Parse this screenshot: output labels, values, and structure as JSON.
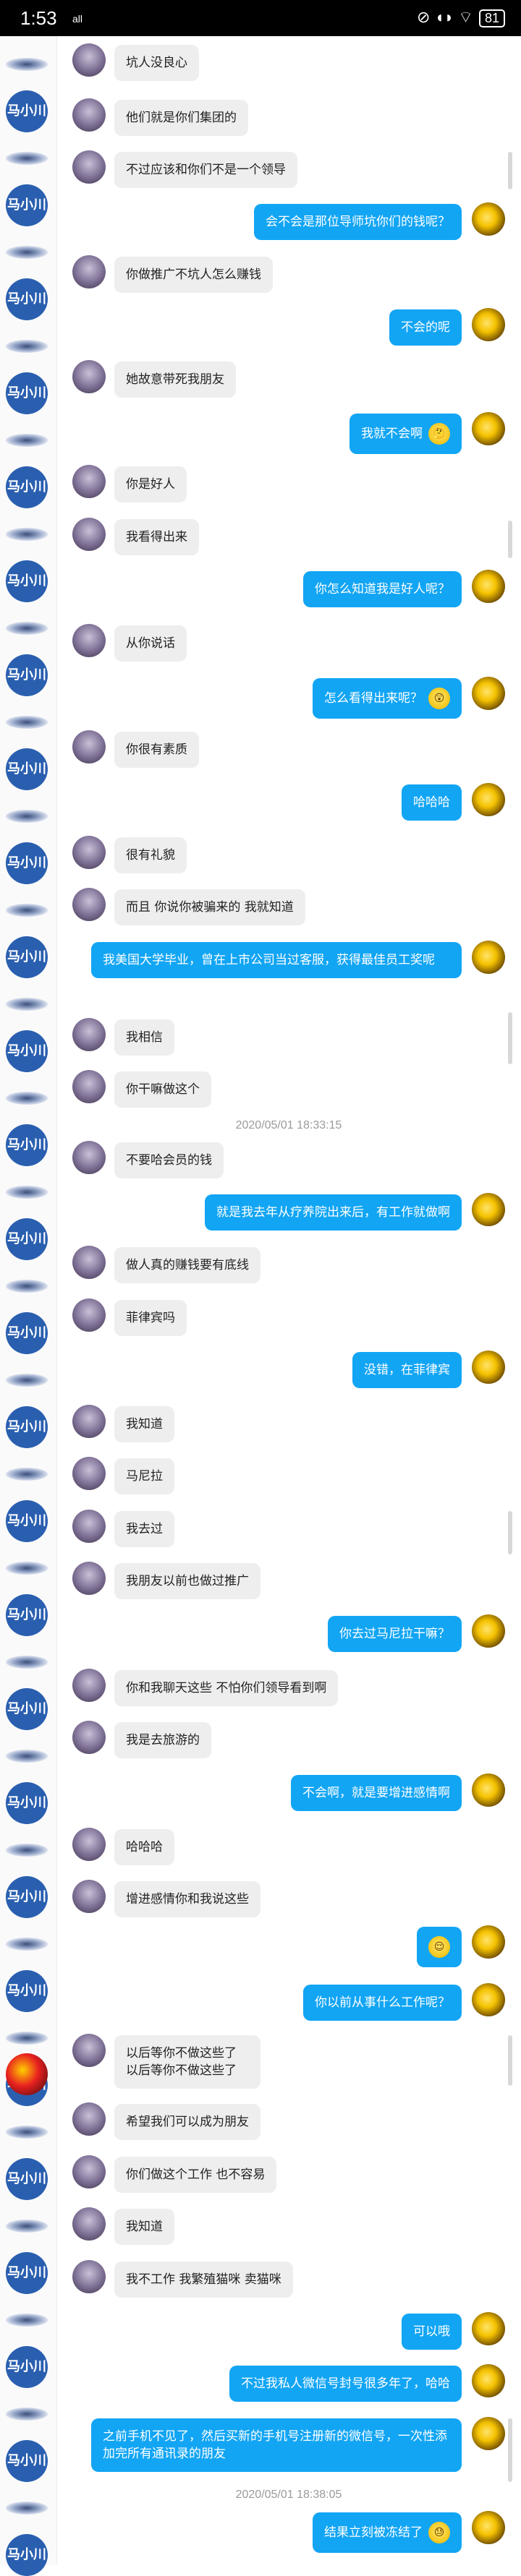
{
  "status_bar": {
    "time": "1:53",
    "signal": "all",
    "icons": "⊘ ◖◗ ⌔",
    "battery": "81"
  },
  "sidebar": {
    "avatar_label": "马小川"
  },
  "timestamps": [
    "2020/05/01 18:33:15",
    "2020/05/01 18:38:05"
  ],
  "messages": [
    {
      "dir": "in",
      "text": "坑人没良心"
    },
    {
      "dir": "in",
      "text": "他们就是你们集团的"
    },
    {
      "dir": "in",
      "text": "不过应该和你们不是一个领导"
    },
    {
      "dir": "out",
      "text": "会不会是那位导师坑你们的钱呢？"
    },
    {
      "dir": "in",
      "text": "你做推广不坑人怎么赚钱"
    },
    {
      "dir": "out",
      "text": "不会的呢"
    },
    {
      "dir": "in",
      "text": "她故意带死我朋友"
    },
    {
      "dir": "out",
      "text": "我就不会啊",
      "emoji": "🤔"
    },
    {
      "dir": "in",
      "text": "你是好人"
    },
    {
      "dir": "in",
      "text": "我看得出来"
    },
    {
      "dir": "out",
      "text": "你怎么知道我是好人呢？"
    },
    {
      "dir": "in",
      "text": "从你说话"
    },
    {
      "dir": "out",
      "text": "怎么看得出来呢？",
      "emoji": "😲"
    },
    {
      "dir": "in",
      "text": "你很有素质"
    },
    {
      "dir": "out",
      "text": "哈哈哈"
    },
    {
      "dir": "in",
      "text": "很有礼貌"
    },
    {
      "dir": "in",
      "text": "而且 你说你被骗来的 我就知道"
    },
    {
      "dir": "out",
      "text": "我美国大学毕业，曾在上市公司当过客服，获得最佳员工奖呢"
    },
    {
      "dir": "in",
      "text": "我相信"
    },
    {
      "dir": "in",
      "text": "你干嘛做这个"
    },
    {
      "dir": "in",
      "text": "不要哈会员的钱"
    },
    {
      "dir": "out",
      "text": "就是我去年从疗养院出来后，有工作就做啊"
    },
    {
      "dir": "in",
      "text": "做人真的赚钱要有底线"
    },
    {
      "dir": "in",
      "text": "菲律宾吗"
    },
    {
      "dir": "out",
      "text": "没错，在菲律宾"
    },
    {
      "dir": "in",
      "text": "我知道"
    },
    {
      "dir": "in",
      "text": "马尼拉"
    },
    {
      "dir": "in",
      "text": "我去过"
    },
    {
      "dir": "in",
      "text": "我朋友以前也做过推广"
    },
    {
      "dir": "out",
      "text": "你去过马尼拉干嘛？"
    },
    {
      "dir": "in",
      "text": "你和我聊天这些 不怕你们领导看到啊"
    },
    {
      "dir": "in",
      "text": "我是去旅游的"
    },
    {
      "dir": "out",
      "text": "不会啊，就是要增进感情啊"
    },
    {
      "dir": "in",
      "text": "哈哈哈"
    },
    {
      "dir": "in",
      "text": "增进感情你和我说这些"
    },
    {
      "dir": "out",
      "text": "",
      "emoji": "😌"
    },
    {
      "dir": "out",
      "text": "你以前从事什么工作呢？"
    },
    {
      "dir": "in",
      "text": "以后等你不做这些了\n以后等你不做这些了"
    },
    {
      "dir": "in",
      "text": "希望我们可以成为朋友"
    },
    {
      "dir": "in",
      "text": "你们做这个工作 也不容易"
    },
    {
      "dir": "in",
      "text": "我知道"
    },
    {
      "dir": "in",
      "text": "我不工作 我繁殖猫咪 卖猫咪"
    },
    {
      "dir": "out",
      "text": "可以哦"
    },
    {
      "dir": "out",
      "text": "不过我私人微信号封号很多年了，哈哈"
    },
    {
      "dir": "out",
      "text": "之前手机不见了，然后买新的手机号注册新的微信号，一次性添加完所有通讯录的朋友"
    },
    {
      "dir": "out",
      "text": "结果立刻被冻结了",
      "emoji": "😓"
    }
  ]
}
